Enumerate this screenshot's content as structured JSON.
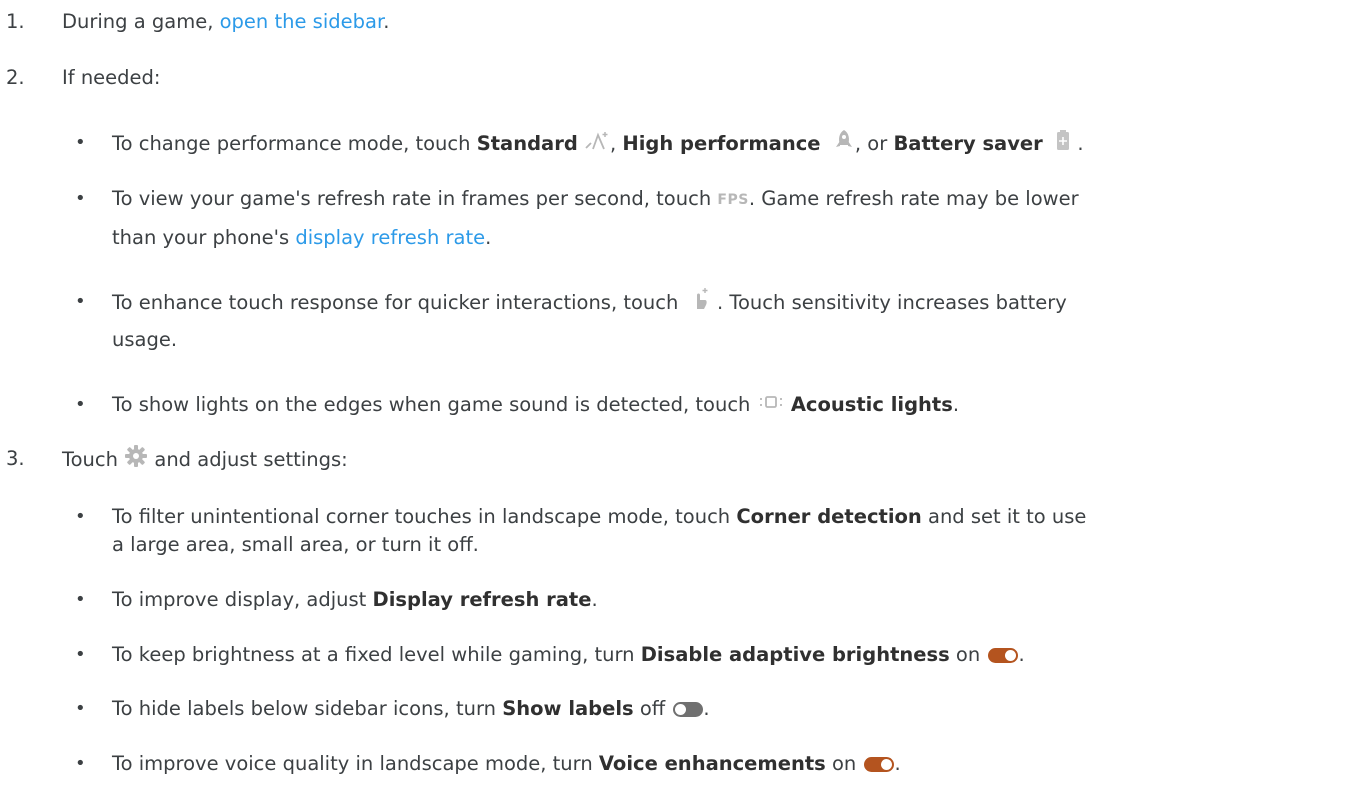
{
  "steps": [
    {
      "num": "1.",
      "before": "During a game, ",
      "link": "open the sidebar",
      "after": "."
    },
    {
      "num": "2.",
      "text": "If needed:"
    },
    {
      "num": "3.",
      "before": "Touch",
      "after": "and adjust settings:"
    }
  ],
  "step2_bullets": {
    "performance": {
      "before": "To change performance mode, touch ",
      "standard": "Standard",
      "comma1": ", ",
      "high": "High performance",
      "or": ", or ",
      "battery": "Battery saver",
      "end": "."
    },
    "fps": {
      "before": "To view your game's refresh rate in frames per second, touch",
      "icon_text": "FPS",
      "after": ". Game refresh rate may be lower",
      "line2_before": "than your phone's ",
      "line2_link": "display refresh rate",
      "line2_after": "."
    },
    "touch": {
      "before": "To enhance touch response for quicker interactions, touch",
      "after": ". Touch sensitivity increases battery",
      "line2": "usage."
    },
    "acoustic": {
      "before": "To show lights on the edges when game sound is detected, touch",
      "bold": "Acoustic lights",
      "after": "."
    }
  },
  "step3_bullets": {
    "corner": {
      "before": "To filter unintentional corner touches in landscape mode, touch ",
      "bold": "Corner detection",
      "after": " and set it to use",
      "line2": "a large area, small area, or turn it off."
    },
    "display": {
      "before": "To improve display, adjust ",
      "bold": "Display refresh rate",
      "after": "."
    },
    "brightness": {
      "before": "To keep brightness at a fixed level while gaming, turn ",
      "bold": "Disable adaptive brightness",
      "after": " on",
      "end": "."
    },
    "labels": {
      "before": "To hide labels below sidebar icons, turn ",
      "bold": "Show labels",
      "after": " off",
      "end": "."
    },
    "voice": {
      "before": "To improve voice quality in landscape mode, turn ",
      "bold": "Voice enhancements",
      "after": " on",
      "end": "."
    }
  },
  "bullet_char": "•",
  "icons": [
    "standard-mode-icon",
    "high-performance-rocket-icon",
    "battery-saver-icon",
    "fps-icon",
    "touch-response-icon",
    "acoustic-lights-icon",
    "settings-gear-icon",
    "toggle-on-icon",
    "toggle-off-icon"
  ],
  "colors": {
    "link": "#2c9ae8",
    "toggle_on": "#b4541f",
    "toggle_off": "#707070",
    "text": "#3c4043",
    "icon_gray": "#b7b7b7"
  }
}
